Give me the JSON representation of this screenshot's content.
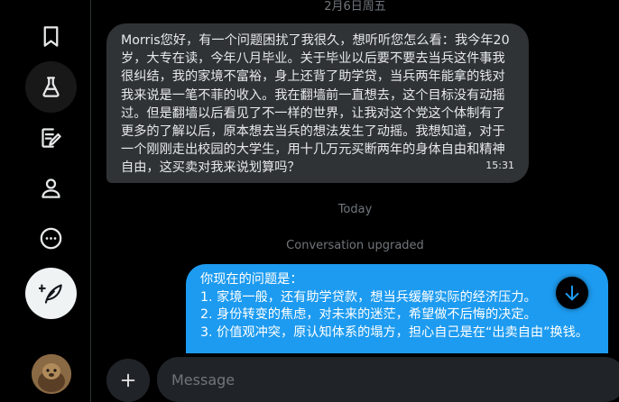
{
  "sidebar": {
    "items": [
      {
        "name": "bookmark-icon"
      },
      {
        "name": "flask-icon"
      },
      {
        "name": "compose-note-icon"
      },
      {
        "name": "profile-icon"
      },
      {
        "name": "more-icon"
      }
    ],
    "compose": {
      "name": "feather-plus-icon"
    }
  },
  "conversation": {
    "date_top": "2月6日周五",
    "incoming": {
      "text": "Morris您好，有一个问题困扰了我很久，想听听您怎么看：我今年20岁，大专在读，今年八月毕业。关于毕业以后要不要去当兵这件事我很纠结，我的家境不富裕，身上还背了助学贷，当兵两年能拿的钱对我来说是一笔不菲的收入。我在翻墙前一直想去，这个目标没有动摇过。但是翻墙以后看见了不一样的世界，让我对这个党这个体制有了更多的了解以后，原本想去当兵的想法发生了动摇。我想知道，对于一个刚刚走出校园的大学生，用十几万元买断两年的身体自由和精神自由，这买卖对我来说划算吗？",
      "time": "15:31"
    },
    "today_label": "Today",
    "upgraded_label": "Conversation upgraded",
    "outgoing": {
      "lines": [
        "你现在的问题是：",
        "1. 家境一般，还有助学贷款，想当兵缓解实际的经济压力。",
        "2. 身份转变的焦虑，对未来的迷茫，希望做不后悔的决定。",
        "3. 价值观冲突，原认知体系的塌方，担心自己是在“出卖自由”换钱。"
      ]
    }
  },
  "composer": {
    "placeholder": "Message"
  },
  "colors": {
    "background": "#000000",
    "incoming_bubble": "#2f3336",
    "outgoing_bubble": "#1d9bf0",
    "muted_text": "#71767b"
  }
}
